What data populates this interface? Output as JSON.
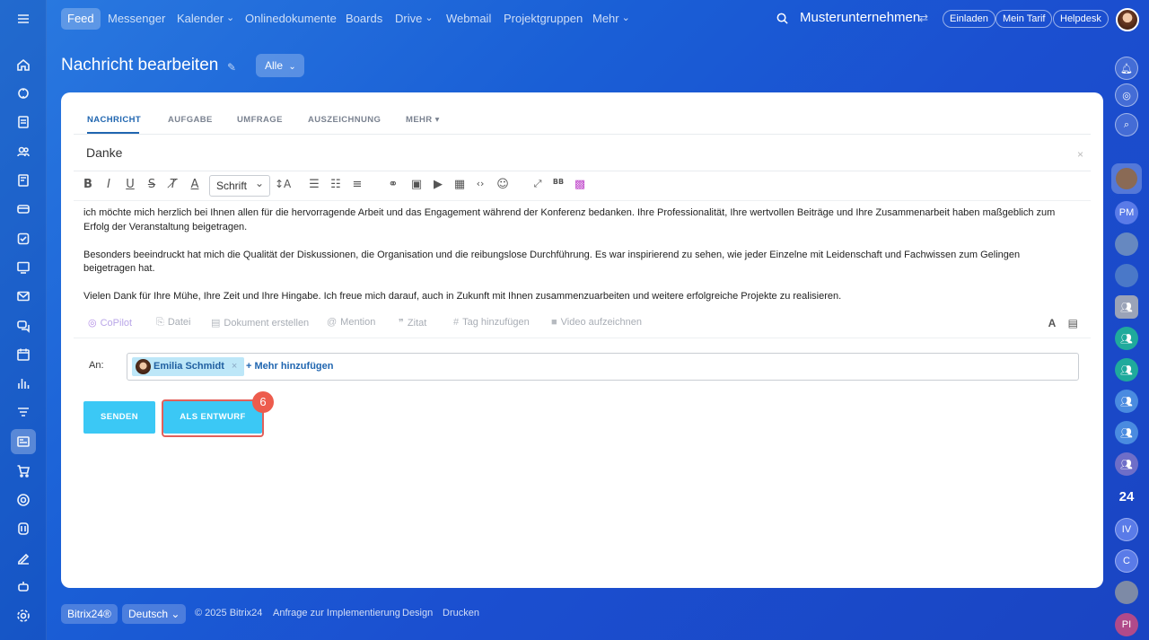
{
  "topbar": {
    "menu_items": [
      {
        "label": "Feed",
        "active": true,
        "dropdown": false
      },
      {
        "label": "Messenger",
        "active": false,
        "dropdown": false
      },
      {
        "label": "Kalender",
        "active": false,
        "dropdown": true
      },
      {
        "label": "Onlinedokumente",
        "active": false,
        "dropdown": false
      },
      {
        "label": "Boards",
        "active": false,
        "dropdown": false
      },
      {
        "label": "Drive",
        "active": false,
        "dropdown": true
      },
      {
        "label": "Webmail",
        "active": false,
        "dropdown": false
      },
      {
        "label": "Projektgruppen",
        "active": false,
        "dropdown": false
      },
      {
        "label": "Mehr",
        "active": false,
        "dropdown": true
      }
    ],
    "company": "Musterunternehmen",
    "buttons": {
      "invite": "Einladen",
      "plan": "Mein Tarif",
      "helpdesk": "Helpdesk"
    }
  },
  "page": {
    "title": "Nachricht bearbeiten",
    "filter": "Alle"
  },
  "editor": {
    "tabs": [
      "NACHRICHT",
      "AUFGABE",
      "UMFRAGE",
      "AUSZEICHNUNG",
      "MEHR"
    ],
    "subject": "Danke",
    "font_select": "Schrift",
    "body_paragraphs": [
      "ich möchte mich herzlich bei Ihnen allen für die hervorragende Arbeit und das Engagement während der Konferenz bedanken. Ihre Professionalität, Ihre wertvollen Beiträge und Ihre Zusammenarbeit haben maßgeblich zum Erfolg der Veranstaltung beigetragen.",
      "Besonders beeindruckt hat mich die Qualität der Diskussionen, die Organisation und die reibungslose Durchführung. Es war inspirierend zu sehen, wie jeder Einzelne mit Leidenschaft und Fachwissen zum Gelingen beigetragen hat.",
      "Vielen Dank für Ihre Mühe, Ihre Zeit und Ihre Hingabe. Ich freue mich darauf, auch in Zukunft mit Ihnen zusammenzuarbeiten und weitere erfolgreiche Projekte zu realisieren."
    ],
    "actions": {
      "copilot": "CoPilot",
      "file": "Datei",
      "create_doc": "Dokument erstellen",
      "mention": "Mention",
      "quote": "Zitat",
      "tag": "Tag hinzufügen",
      "video": "Video aufzeichnen"
    },
    "to_label": "An:",
    "recipient": "Emilia Schmidt",
    "add_more": "+ Mehr hinzufügen",
    "send": "SENDEN",
    "draft": "ALS ENTWURF",
    "step": "6"
  },
  "right_rail": {
    "badge_24": "24",
    "initials": [
      "PM",
      "IV",
      "C",
      "PI"
    ]
  },
  "footer": {
    "brand": "Bitrix24®",
    "language": "Deutsch",
    "copyright": "© 2025 Bitrix24",
    "link_impl": "Anfrage zur Implementierung",
    "link_design": "Design",
    "link_print": "Drucken"
  },
  "colors": {
    "accent": "#3bc8f5",
    "tab_active": "#2066b0",
    "highlight": "#e2605a",
    "badge": "#ed5c4d"
  }
}
